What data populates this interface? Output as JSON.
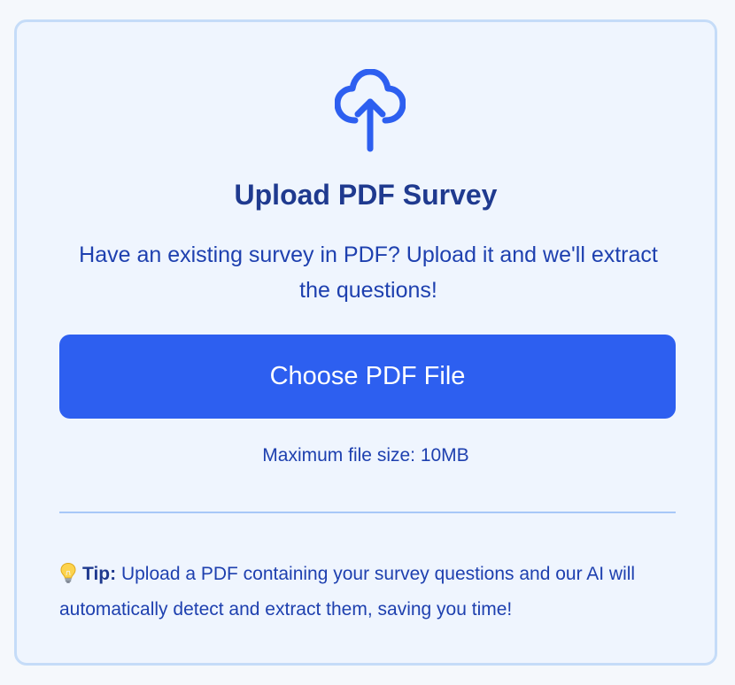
{
  "upload_card": {
    "icon": "cloud-upload-icon",
    "title": "Upload PDF Survey",
    "subtitle": "Have an existing survey in PDF? Upload it and we'll extract the questions!",
    "button_label": "Choose PDF File",
    "max_size_text": "Maximum file size: 10MB",
    "tip": {
      "icon": "lightbulb-icon",
      "label": "Tip:",
      "text": " Upload a PDF containing your survey questions and our AI will automatically detect and extract them, saving you time!"
    }
  },
  "colors": {
    "accent": "#2d5ff0",
    "heading": "#1f3a8f",
    "text": "#1e40af",
    "card_background": "#eff5fe",
    "card_border": "#c5dcf8"
  }
}
